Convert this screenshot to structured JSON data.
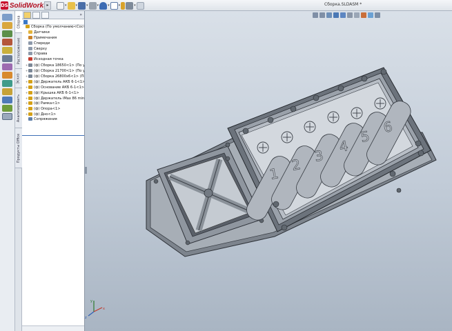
{
  "app": {
    "logo_text": "SolidWorks",
    "logo_mark": "DS",
    "document_title": "Сборка.SLDASM *"
  },
  "toolbar": {
    "icons": [
      "new-icon",
      "open-icon",
      "save-icon",
      "print-icon",
      "undo-icon",
      "select-icon",
      "rebuild-icon",
      "options-icon",
      "help-icon"
    ]
  },
  "left_strip": {
    "icons": [
      "assembly-icon",
      "sketch-icon",
      "evaluate-icon",
      "mate-icon",
      "dimension-icon",
      "office-icon",
      "appearance-icon",
      "weld-icon",
      "surface-icon",
      "mold-icon",
      "sheetmetal-icon",
      "display-icon",
      "view-icon"
    ]
  },
  "vertical_tabs": [
    "Сборка",
    "Расположение",
    "Эскиз",
    "Анализировать",
    "Продукты Office"
  ],
  "tree": {
    "items": [
      {
        "label": "Сборка  (По умолчанию<Сост",
        "icon": "assembly-icon",
        "level": 0,
        "color": "#d4a017"
      },
      {
        "label": "Датчики",
        "icon": "folder-icon",
        "level": 1,
        "color": "#e3b33b"
      },
      {
        "label": "Примечания",
        "icon": "annotation-icon",
        "level": 1,
        "color": "#c9812a"
      },
      {
        "label": "Спереди",
        "icon": "plane-icon",
        "level": 1,
        "color": "#8d99aa"
      },
      {
        "label": "Сверху",
        "icon": "plane-icon",
        "level": 1,
        "color": "#8d99aa"
      },
      {
        "label": "Справа",
        "icon": "plane-icon",
        "level": 1,
        "color": "#8d99aa"
      },
      {
        "label": "Исходная точка",
        "icon": "origin-icon",
        "level": 1,
        "color": "#c43c2e"
      },
      {
        "label": "(ф) Сборка 18650<1> (По ум",
        "icon": "subassembly-icon",
        "level": 1,
        "color": "#7b8796"
      },
      {
        "label": "(ф) Сборка 21700<1> (По ум",
        "icon": "subassembly-icon",
        "level": 1,
        "color": "#7b8796"
      },
      {
        "label": "(ф) Сборка 26800х6<1> (По",
        "icon": "subassembly-icon",
        "level": 1,
        "color": "#7b8796"
      },
      {
        "label": "(ф) Держатель АКБ 6-1<1>",
        "icon": "part-icon",
        "level": 1,
        "color": "#d4a017"
      },
      {
        "label": "(ф) Основание АКБ 6-1<1>",
        "icon": "part-icon",
        "level": 1,
        "color": "#d4a017"
      },
      {
        "label": "(ф) Крышка АКБ 6-1<1>",
        "icon": "part-icon",
        "level": 1,
        "color": "#d4a017"
      },
      {
        "label": "(ф) Держатель iMax 86 mini",
        "icon": "part-icon",
        "level": 1,
        "color": "#d4a017"
      },
      {
        "label": "(ф) Рамка<1>",
        "icon": "part-icon",
        "level": 1,
        "color": "#d4a017"
      },
      {
        "label": "(ф) Опора<1>",
        "icon": "part-icon",
        "level": 1,
        "color": "#d4a017"
      },
      {
        "label": "(ф) Дно<1>",
        "icon": "part-icon",
        "level": 1,
        "color": "#d4a017"
      },
      {
        "label": "Сопряжения",
        "icon": "mates-icon",
        "level": 1,
        "color": "#5f7fa8"
      }
    ]
  },
  "model": {
    "slot_numbers": [
      "1",
      "2",
      "3",
      "4",
      "5",
      "6"
    ]
  },
  "triad": {
    "x": "x",
    "y": "y",
    "z": "z"
  }
}
